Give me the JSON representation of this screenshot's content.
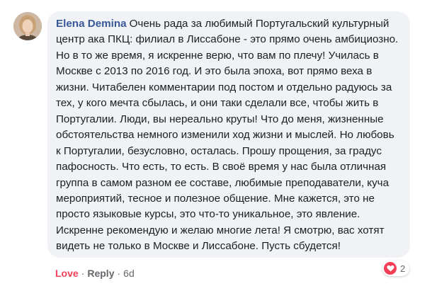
{
  "comment": {
    "author": "Elena Demina",
    "text": "Очень рада за любимый Португальский культурный центр ака ПКЦ: филиал в Лиссабоне - это прямо очень амбициозно. Но в то же время, я искренне верю, что вам по плечу! Училась в Москве с 2013 по 2016 год. И это была эпоха, вот прямо веха в жизни. Читабелен комментарии под постом и отдельно радуюсь за тех, у кого мечта сбылась, и они таки сделали все, чтобы жить в Португалии. Люди, вы нереально круты! Что до меня, жизненные обстоятельства немного изменили ход жизни и мыслей. Но любовь к Португалии, безусловно, осталась. Прошу прощения, за градус пафосность. Что есть, то есть. В своё время у нас была отличная группа в самом разном ее составе, любимые преподаватели, куча мероприятий, тесное и полезное общение. Мне кажется, это не просто языковые курсы, это что-то уникальное, это явление. Искренне рекомендую и желаю многие лета! Я смотрю, вас хотят видеть не только в Москве и Лиссабоне. Пусть сбудется!"
  },
  "actions": {
    "love_label": "Love",
    "separator": "·",
    "reply_label": "Reply",
    "timestamp": "6d"
  },
  "reactions": {
    "icon": "heart-icon",
    "count": "2",
    "color": "#f33e58"
  }
}
